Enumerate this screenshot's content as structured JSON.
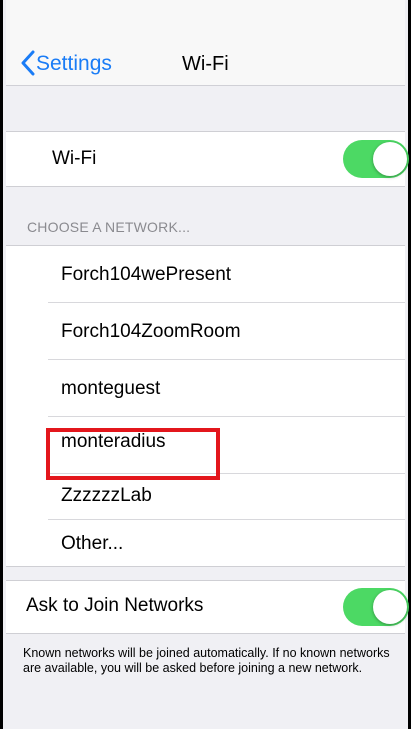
{
  "navbar": {
    "back_label": "Settings",
    "title": "Wi-Fi",
    "back_icon": "chevron-left-icon",
    "accent_color": "#1a7cf6"
  },
  "wifi": {
    "label": "Wi-Fi",
    "enabled": true,
    "toggle_color": "#4cd964"
  },
  "networks": {
    "header": "CHOOSE A NETWORK...",
    "items": [
      "Forch104wePresent",
      "Forch104ZoomRoom",
      "monteguest",
      "monteradius",
      "ZzzzzzLab",
      "Other..."
    ],
    "highlighted": "monteradius",
    "highlight_color": "#e3161c"
  },
  "ask_to_join": {
    "label": "Ask to Join Networks",
    "enabled": true,
    "note": "Known networks will be joined automatically. If no known networks are available, you will be asked before joining a new network."
  }
}
